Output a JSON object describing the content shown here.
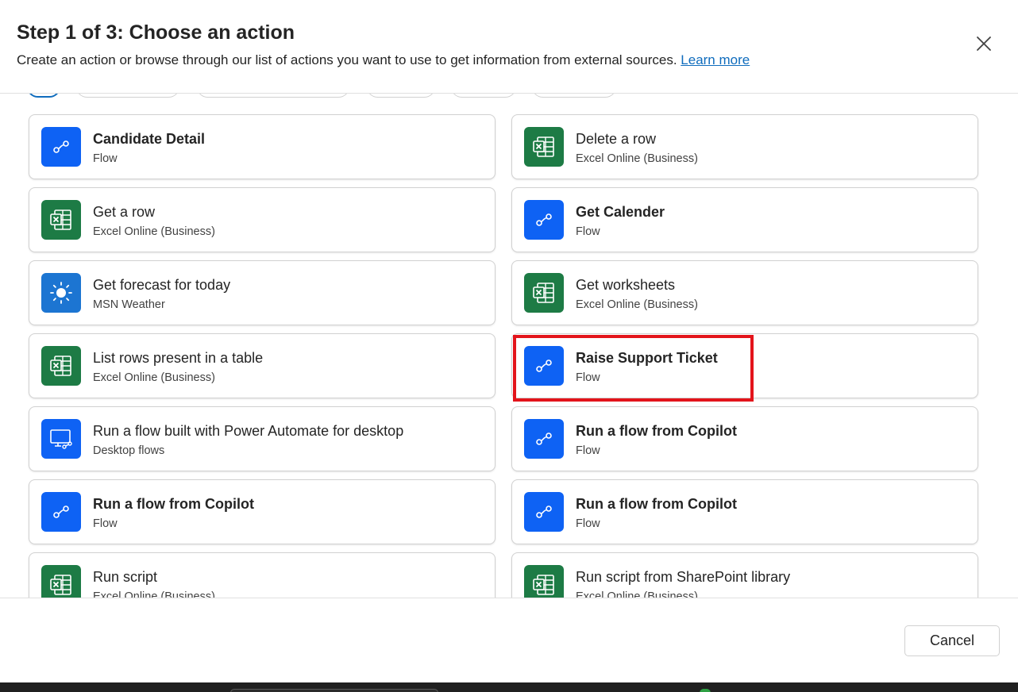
{
  "dialog": {
    "title": "Step 1 of 3: Choose an action",
    "subtitle": "Create an action or browse through our list of actions you want to use to get information from external sources.",
    "learn_more": "Learn more",
    "close_icon": "close-icon"
  },
  "actions": [
    {
      "name": "Candidate Detail",
      "source": "Flow",
      "icon": "flow-icon",
      "bold": true
    },
    {
      "name": "Delete a row",
      "source": "Excel Online (Business)",
      "icon": "excel-icon",
      "bold": false
    },
    {
      "name": "Get a row",
      "source": "Excel Online (Business)",
      "icon": "excel-icon",
      "bold": false
    },
    {
      "name": "Get Calender",
      "source": "Flow",
      "icon": "flow-icon",
      "bold": true
    },
    {
      "name": "Get forecast for today",
      "source": "MSN Weather",
      "icon": "weather-icon",
      "bold": false
    },
    {
      "name": "Get worksheets",
      "source": "Excel Online (Business)",
      "icon": "excel-icon",
      "bold": false
    },
    {
      "name": "List rows present in a table",
      "source": "Excel Online (Business)",
      "icon": "excel-icon",
      "bold": false
    },
    {
      "name": "Raise Support Ticket",
      "source": "Flow",
      "icon": "flow-icon",
      "bold": true
    },
    {
      "name": "Run a flow built with Power Automate for desktop",
      "source": "Desktop flows",
      "icon": "desktop-flow-icon",
      "bold": false
    },
    {
      "name": "Run a flow from Copilot",
      "source": "Flow",
      "icon": "flow-icon",
      "bold": true
    },
    {
      "name": "Run a flow from Copilot",
      "source": "Flow",
      "icon": "flow-icon",
      "bold": true
    },
    {
      "name": "Run a flow from Copilot",
      "source": "Flow",
      "icon": "flow-icon",
      "bold": true
    },
    {
      "name": "Run script",
      "source": "Excel Online (Business)",
      "icon": "excel-icon",
      "bold": false
    },
    {
      "name": "Run script from SharePoint library",
      "source": "Excel Online (Business)",
      "icon": "excel-icon",
      "bold": false
    }
  ],
  "highlighted_action": "Raise Support Ticket",
  "footer": {
    "cancel_label": "Cancel"
  },
  "colors": {
    "flow_icon_bg": "#0e62f4",
    "excel_icon_bg": "#1d7b45",
    "weather_icon_bg": "#1c75d2",
    "highlight_border": "#e3141b",
    "link": "#0f6cbd"
  }
}
